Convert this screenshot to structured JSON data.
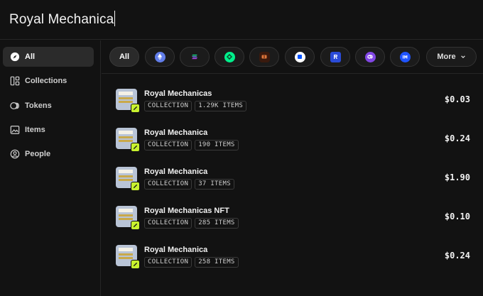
{
  "search": {
    "query": "Royal Mechanica"
  },
  "sidebar": {
    "items": [
      {
        "label": "All",
        "icon": "compass-icon",
        "active": true
      },
      {
        "label": "Collections",
        "icon": "grid-layout-icon",
        "active": false
      },
      {
        "label": "Tokens",
        "icon": "coins-icon",
        "active": false
      },
      {
        "label": "Items",
        "icon": "image-icon",
        "active": false
      },
      {
        "label": "People",
        "icon": "user-circle-icon",
        "active": false
      }
    ]
  },
  "chips": {
    "all_label": "All",
    "more_label": "More",
    "chains": [
      {
        "icon": "ethereum-icon",
        "color": "#627eea"
      },
      {
        "icon": "solana-icon",
        "color": "#1b1b1b"
      },
      {
        "icon": "flow-icon",
        "color": "#00ef8b"
      },
      {
        "icon": "ronin-icon",
        "color": "#7a3a1a"
      },
      {
        "icon": "base-icon",
        "color": "#0052ff"
      },
      {
        "icon": "arbitrum-icon",
        "color": "#213147"
      },
      {
        "icon": "polygon-icon",
        "color": "#8247e5"
      },
      {
        "icon": "immutable-icon",
        "color": "#1f54ff"
      }
    ]
  },
  "results": [
    {
      "name": "Royal Mechanicas",
      "type": "COLLECTION",
      "items": "1.29K ITEMS",
      "price": "$0.03"
    },
    {
      "name": "Royal Mechanica",
      "type": "COLLECTION",
      "items": "190 ITEMS",
      "price": "$0.24"
    },
    {
      "name": "Royal Mechanica",
      "type": "COLLECTION",
      "items": "37 ITEMS",
      "price": "$1.90"
    },
    {
      "name": "Royal Mechanicas NFT",
      "type": "COLLECTION",
      "items": "285 ITEMS",
      "price": "$0.10"
    },
    {
      "name": "Royal Mechanica",
      "type": "COLLECTION",
      "items": "258 ITEMS",
      "price": "$0.24"
    }
  ],
  "colors": {
    "background": "#121212",
    "accent_badge": "#c8f22e",
    "active_nav": "#2b2b2b"
  }
}
